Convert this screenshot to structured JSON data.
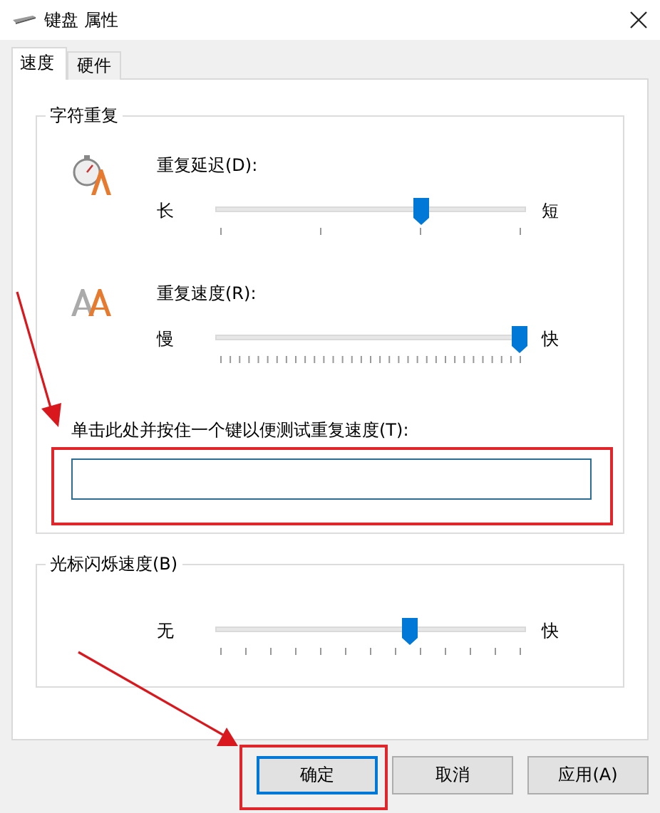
{
  "window": {
    "title": "键盘 属性"
  },
  "tabs": [
    {
      "label": "速度",
      "selected": true
    },
    {
      "label": "硬件",
      "selected": false
    }
  ],
  "character_repeat": {
    "title": "字符重复",
    "sliders": [
      {
        "kind": "delay",
        "label": "重复延迟(D):",
        "min_label": "长",
        "max_label": "短",
        "level": 0.667
      },
      {
        "kind": "rate",
        "label": "重复速度(R):",
        "min_label": "慢",
        "max_label": "快",
        "level": 1
      }
    ],
    "test_field": {
      "label": "单击此处并按住一个键以便测试重复速度(T):"
    }
  },
  "cursor_blink": {
    "title": "光标闪烁速度(B)",
    "slider": {
      "kind": "blink",
      "min_label": "无",
      "max_label": "快",
      "level": 0.63
    }
  },
  "buttons": [
    {
      "label": "确定",
      "default": true
    },
    {
      "label": "取消",
      "default": false
    },
    {
      "label": "应用(A)",
      "default": false
    }
  ]
}
